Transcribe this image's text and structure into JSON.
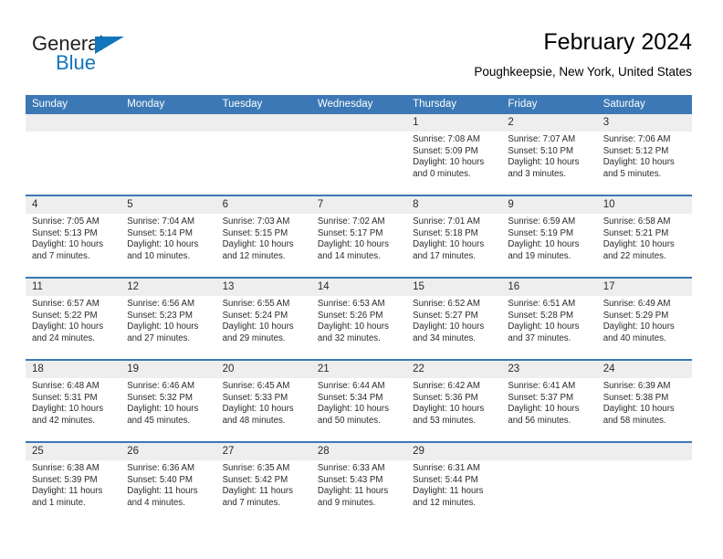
{
  "brand": {
    "word_one": "General",
    "word_two": "Blue",
    "triangle_icon": "triangle-icon",
    "accent_color": "#1175bc"
  },
  "header": {
    "title": "February 2024",
    "subtitle": "Poughkeepsie, New York, United States"
  },
  "theme": {
    "header_blue": "#3b78b5",
    "daynum_band": "#eeeeee",
    "text": "#2b2b2b"
  },
  "calendar": {
    "weekdays": [
      "Sunday",
      "Monday",
      "Tuesday",
      "Wednesday",
      "Thursday",
      "Friday",
      "Saturday"
    ],
    "weeks": [
      [
        {
          "day": "",
          "lines": []
        },
        {
          "day": "",
          "lines": []
        },
        {
          "day": "",
          "lines": []
        },
        {
          "day": "",
          "lines": []
        },
        {
          "day": "1",
          "lines": [
            "Sunrise: 7:08 AM",
            "Sunset: 5:09 PM",
            "Daylight: 10 hours",
            "and 0 minutes."
          ]
        },
        {
          "day": "2",
          "lines": [
            "Sunrise: 7:07 AM",
            "Sunset: 5:10 PM",
            "Daylight: 10 hours",
            "and 3 minutes."
          ]
        },
        {
          "day": "3",
          "lines": [
            "Sunrise: 7:06 AM",
            "Sunset: 5:12 PM",
            "Daylight: 10 hours",
            "and 5 minutes."
          ]
        }
      ],
      [
        {
          "day": "4",
          "lines": [
            "Sunrise: 7:05 AM",
            "Sunset: 5:13 PM",
            "Daylight: 10 hours",
            "and 7 minutes."
          ]
        },
        {
          "day": "5",
          "lines": [
            "Sunrise: 7:04 AM",
            "Sunset: 5:14 PM",
            "Daylight: 10 hours",
            "and 10 minutes."
          ]
        },
        {
          "day": "6",
          "lines": [
            "Sunrise: 7:03 AM",
            "Sunset: 5:15 PM",
            "Daylight: 10 hours",
            "and 12 minutes."
          ]
        },
        {
          "day": "7",
          "lines": [
            "Sunrise: 7:02 AM",
            "Sunset: 5:17 PM",
            "Daylight: 10 hours",
            "and 14 minutes."
          ]
        },
        {
          "day": "8",
          "lines": [
            "Sunrise: 7:01 AM",
            "Sunset: 5:18 PM",
            "Daylight: 10 hours",
            "and 17 minutes."
          ]
        },
        {
          "day": "9",
          "lines": [
            "Sunrise: 6:59 AM",
            "Sunset: 5:19 PM",
            "Daylight: 10 hours",
            "and 19 minutes."
          ]
        },
        {
          "day": "10",
          "lines": [
            "Sunrise: 6:58 AM",
            "Sunset: 5:21 PM",
            "Daylight: 10 hours",
            "and 22 minutes."
          ]
        }
      ],
      [
        {
          "day": "11",
          "lines": [
            "Sunrise: 6:57 AM",
            "Sunset: 5:22 PM",
            "Daylight: 10 hours",
            "and 24 minutes."
          ]
        },
        {
          "day": "12",
          "lines": [
            "Sunrise: 6:56 AM",
            "Sunset: 5:23 PM",
            "Daylight: 10 hours",
            "and 27 minutes."
          ]
        },
        {
          "day": "13",
          "lines": [
            "Sunrise: 6:55 AM",
            "Sunset: 5:24 PM",
            "Daylight: 10 hours",
            "and 29 minutes."
          ]
        },
        {
          "day": "14",
          "lines": [
            "Sunrise: 6:53 AM",
            "Sunset: 5:26 PM",
            "Daylight: 10 hours",
            "and 32 minutes."
          ]
        },
        {
          "day": "15",
          "lines": [
            "Sunrise: 6:52 AM",
            "Sunset: 5:27 PM",
            "Daylight: 10 hours",
            "and 34 minutes."
          ]
        },
        {
          "day": "16",
          "lines": [
            "Sunrise: 6:51 AM",
            "Sunset: 5:28 PM",
            "Daylight: 10 hours",
            "and 37 minutes."
          ]
        },
        {
          "day": "17",
          "lines": [
            "Sunrise: 6:49 AM",
            "Sunset: 5:29 PM",
            "Daylight: 10 hours",
            "and 40 minutes."
          ]
        }
      ],
      [
        {
          "day": "18",
          "lines": [
            "Sunrise: 6:48 AM",
            "Sunset: 5:31 PM",
            "Daylight: 10 hours",
            "and 42 minutes."
          ]
        },
        {
          "day": "19",
          "lines": [
            "Sunrise: 6:46 AM",
            "Sunset: 5:32 PM",
            "Daylight: 10 hours",
            "and 45 minutes."
          ]
        },
        {
          "day": "20",
          "lines": [
            "Sunrise: 6:45 AM",
            "Sunset: 5:33 PM",
            "Daylight: 10 hours",
            "and 48 minutes."
          ]
        },
        {
          "day": "21",
          "lines": [
            "Sunrise: 6:44 AM",
            "Sunset: 5:34 PM",
            "Daylight: 10 hours",
            "and 50 minutes."
          ]
        },
        {
          "day": "22",
          "lines": [
            "Sunrise: 6:42 AM",
            "Sunset: 5:36 PM",
            "Daylight: 10 hours",
            "and 53 minutes."
          ]
        },
        {
          "day": "23",
          "lines": [
            "Sunrise: 6:41 AM",
            "Sunset: 5:37 PM",
            "Daylight: 10 hours",
            "and 56 minutes."
          ]
        },
        {
          "day": "24",
          "lines": [
            "Sunrise: 6:39 AM",
            "Sunset: 5:38 PM",
            "Daylight: 10 hours",
            "and 58 minutes."
          ]
        }
      ],
      [
        {
          "day": "25",
          "lines": [
            "Sunrise: 6:38 AM",
            "Sunset: 5:39 PM",
            "Daylight: 11 hours",
            "and 1 minute."
          ]
        },
        {
          "day": "26",
          "lines": [
            "Sunrise: 6:36 AM",
            "Sunset: 5:40 PM",
            "Daylight: 11 hours",
            "and 4 minutes."
          ]
        },
        {
          "day": "27",
          "lines": [
            "Sunrise: 6:35 AM",
            "Sunset: 5:42 PM",
            "Daylight: 11 hours",
            "and 7 minutes."
          ]
        },
        {
          "day": "28",
          "lines": [
            "Sunrise: 6:33 AM",
            "Sunset: 5:43 PM",
            "Daylight: 11 hours",
            "and 9 minutes."
          ]
        },
        {
          "day": "29",
          "lines": [
            "Sunrise: 6:31 AM",
            "Sunset: 5:44 PM",
            "Daylight: 11 hours",
            "and 12 minutes."
          ]
        },
        {
          "day": "",
          "lines": []
        },
        {
          "day": "",
          "lines": []
        }
      ]
    ]
  }
}
